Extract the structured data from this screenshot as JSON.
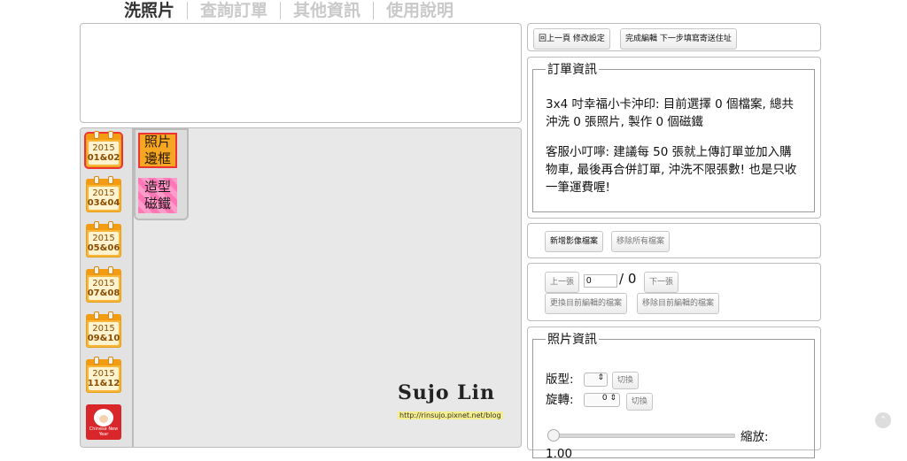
{
  "nav": {
    "tabs": [
      "洗照片",
      "查詢訂單",
      "其他資訊",
      "使用說明"
    ]
  },
  "dates": [
    "2015",
    "01&02",
    "2015",
    "03&04",
    "2015",
    "05&06",
    "2015",
    "07&08",
    "2015",
    "09&10",
    "2015",
    "11&12"
  ],
  "new_year_caption": "Chinese New Year",
  "categories": {
    "frame_label": "照片\n邊框",
    "magnet_label": "造型\n磁鐵"
  },
  "logo": {
    "name": "Sujo Lin",
    "url": "http://rinsujo.pixnet.net/blog"
  },
  "toolbar": {
    "back_label": "回上一頁 修改設定",
    "done_label": "完成編輯 下一步填寫寄送住址"
  },
  "order": {
    "legend": "訂單資訊",
    "summary": "3x4 吋幸福小卡沖印: 目前選擇 0 個檔案, 總共沖洗 0 張照片, 製作 0 個磁鐵",
    "tip": "客服小叮嚀: 建議每 50 張就上傳訂單並加入購物車, 最後再合併訂單, 沖洗不限張數! 也是只收一筆運費喔!"
  },
  "files": {
    "add_label": "新增影像檔案",
    "remove_all_label": "移除所有檔案"
  },
  "pager": {
    "prev_label": "上一張",
    "current_value": "0",
    "total": "/ 0",
    "next_label": "下一張",
    "replace_label": "更換目前編輯的檔案",
    "remove_current_label": "移除目前編輯的檔案"
  },
  "photo": {
    "legend": "照片資訊",
    "layout_label": "版型:",
    "switch_label": "切換",
    "rotate_label": "旋轉:",
    "rotate_value": "0",
    "zoom_label": "縮放:",
    "zoom_value": "1.00"
  }
}
